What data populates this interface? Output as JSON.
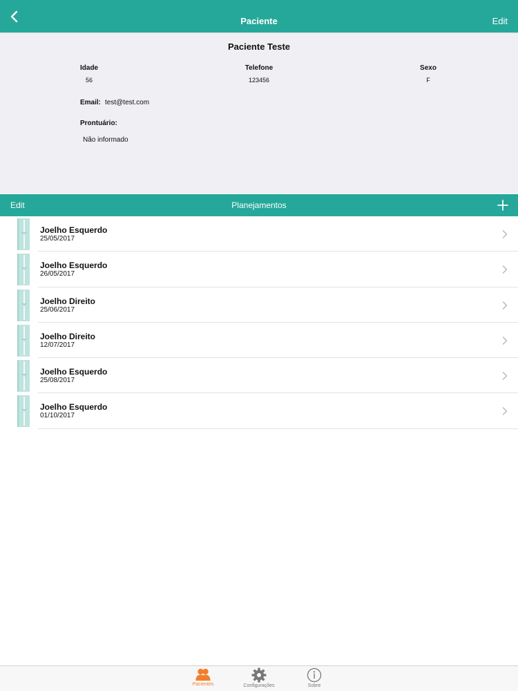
{
  "navbar": {
    "title": "Paciente",
    "edit_label": "Edit",
    "back_icon": "chevron-left-icon"
  },
  "patient": {
    "name": "Paciente Teste",
    "age_label": "Idade",
    "age": "56",
    "phone_label": "Telefone",
    "phone": "123456",
    "sex_label": "Sexo",
    "sex": "F",
    "email_label": "Email:",
    "email": "test@test.com",
    "record_label": "Prontuário:",
    "record": "Não informado"
  },
  "plans_bar": {
    "edit_label": "Edit",
    "title": "Planejamentos",
    "add_icon": "plus-icon"
  },
  "plans": [
    {
      "title": "Joelho Esquerdo",
      "date": "25/05/2017"
    },
    {
      "title": "Joelho Esquerdo",
      "date": "26/05/2017"
    },
    {
      "title": "Joelho Direito",
      "date": "25/06/2017"
    },
    {
      "title": "Joelho Direito",
      "date": "12/07/2017"
    },
    {
      "title": "Joelho Esquerdo",
      "date": "25/08/2017"
    },
    {
      "title": "Joelho Esquerdo",
      "date": "01/10/2017"
    }
  ],
  "tabbar": {
    "items": [
      {
        "label": "Pacientes",
        "icon": "patients-icon",
        "active": true
      },
      {
        "label": "Configurações",
        "icon": "gear-icon",
        "active": false
      },
      {
        "label": "Sobre",
        "icon": "info-icon",
        "active": false
      }
    ]
  },
  "colors": {
    "accent": "#25a89a",
    "active_tab": "#f27f2c",
    "panel_bg": "#efeff4"
  }
}
